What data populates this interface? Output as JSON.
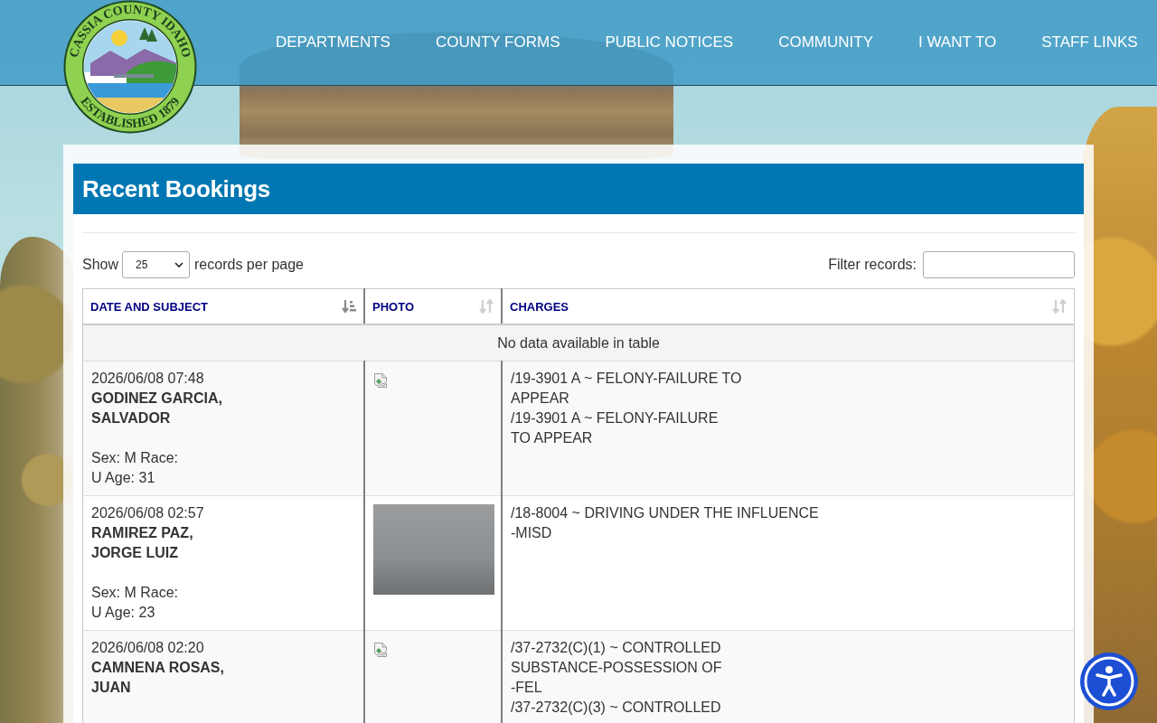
{
  "header": {
    "logo": {
      "top_text": "CASSIA COUNTY IDAHO",
      "bottom_text": "ESTABLISHED 1879"
    },
    "nav": [
      "DEPARTMENTS",
      "COUNTY FORMS",
      "PUBLIC NOTICES",
      "COMMUNITY",
      "I WANT TO",
      "STAFF LINKS"
    ]
  },
  "page_title": "Recent Bookings",
  "length_control": {
    "label_before": "Show",
    "value": "25",
    "label_after": "records per page"
  },
  "filter": {
    "label": "Filter records:"
  },
  "table": {
    "columns": [
      {
        "label": "DATE AND SUBJECT",
        "sorted": true
      },
      {
        "label": "PHOTO",
        "sorted": false
      },
      {
        "label": "CHARGES",
        "sorted": false
      }
    ],
    "empty_message": "No data available in table",
    "rows": [
      {
        "date": "2026/06/08 07:48",
        "name": "GODINEZ GARCIA,\nSALVADOR",
        "details": "Sex: M Race:\nU Age: 31",
        "photo": {
          "kind": "broken"
        },
        "charges": [
          "/19-3901 A ~ FELONY-FAILURE TO\nAPPEAR",
          "/19-3901 A ~ FELONY-FAILURE\nTO APPEAR"
        ]
      },
      {
        "date": "2026/06/08 02:57",
        "name": "RAMIREZ PAZ,\nJORGE LUIZ",
        "details": "Sex: M Race:\nU Age: 23",
        "photo": {
          "kind": "photo"
        },
        "charges": [
          "/18-8004 ~ DRIVING UNDER THE INFLUENCE\n-MISD"
        ]
      },
      {
        "date": "2026/06/08 02:20",
        "name": "CAMNENA ROSAS,\nJUAN",
        "photo": {
          "kind": "broken"
        },
        "charges": [
          "/37-2732(C)(1) ~ CONTROLLED\nSUBSTANCE-POSSESSION OF\n-FEL",
          "/37-2732(C)(3) ~ CONTROLLED"
        ]
      }
    ]
  }
}
